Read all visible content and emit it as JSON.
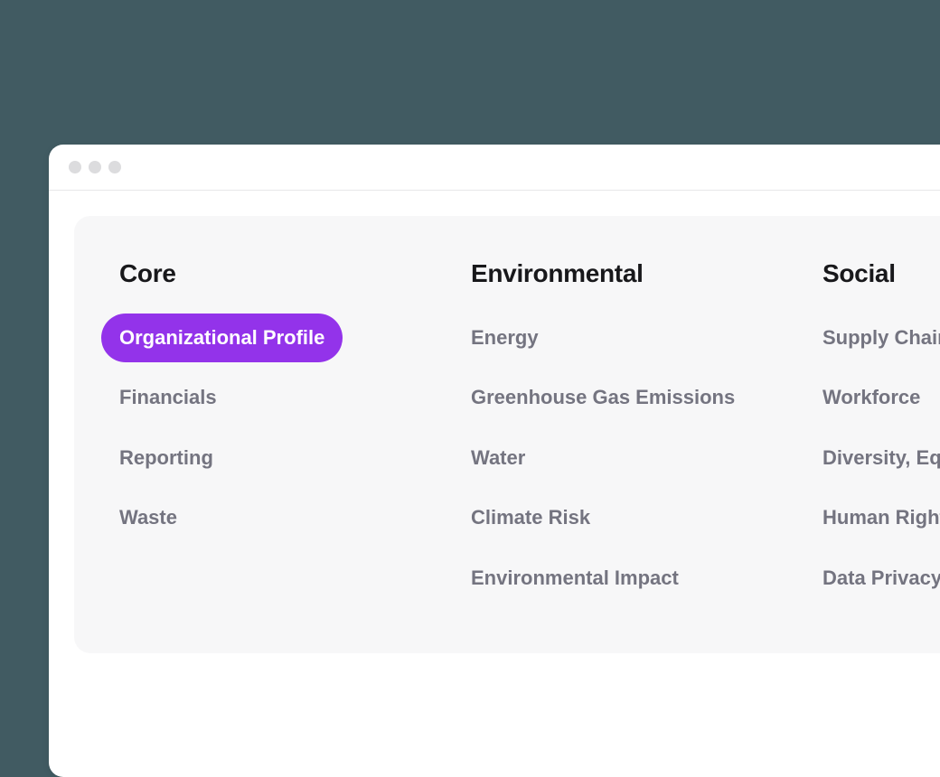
{
  "columns": [
    {
      "heading": "Core",
      "items": [
        {
          "label": "Organizational Profile",
          "active": true
        },
        {
          "label": "Financials",
          "active": false
        },
        {
          "label": "Reporting",
          "active": false
        },
        {
          "label": "Waste",
          "active": false
        }
      ]
    },
    {
      "heading": "Environmental",
      "items": [
        {
          "label": "Energy",
          "active": false
        },
        {
          "label": "Greenhouse Gas Emissions",
          "active": false
        },
        {
          "label": "Water",
          "active": false
        },
        {
          "label": "Climate Risk",
          "active": false
        },
        {
          "label": "Environmental Impact",
          "active": false
        }
      ]
    },
    {
      "heading": "Social",
      "items": [
        {
          "label": "Supply Chain",
          "active": false
        },
        {
          "label": "Workforce",
          "active": false
        },
        {
          "label": "Diversity, Equity",
          "active": false
        },
        {
          "label": "Human Rights",
          "active": false
        },
        {
          "label": "Data Privacy",
          "active": false
        }
      ]
    }
  ]
}
